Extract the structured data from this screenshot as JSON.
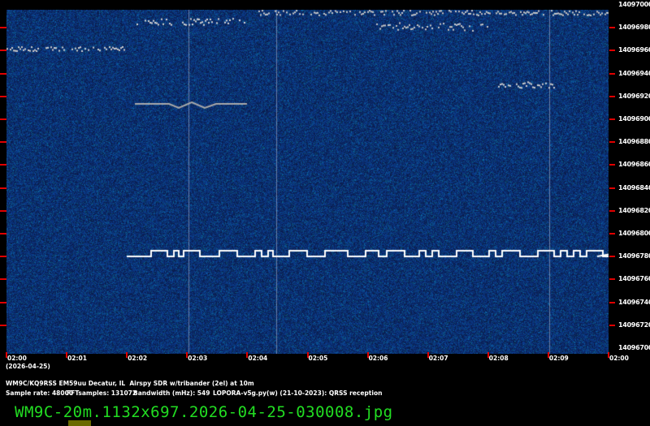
{
  "y_axis": {
    "labels": [
      "14097000",
      "14096980",
      "14096960",
      "14096940",
      "14096920",
      "14096900",
      "14096880",
      "14096860",
      "14096840",
      "14096820",
      "14096800",
      "14096780",
      "14096760",
      "14096740",
      "14096720",
      "14096700"
    ]
  },
  "x_axis": {
    "labels": [
      "02:00",
      "02:01",
      "02:02",
      "02:03",
      "02:04",
      "02:05",
      "02:06",
      "02:07",
      "02:08",
      "02:09",
      "02:00"
    ],
    "date": "(2026-04-25)"
  },
  "info": {
    "line1": "WM9C/KQ9RSS EM59uu Decatur, IL  Airspy SDR w/tribander (2el) at 10m",
    "sample_rate": "Sample rate: 48000",
    "fft": "FFTsamples: 131072",
    "bandwidth": "Bandwidth (mHz): 549",
    "software": "LOPORA-v5g.py(w) (21-10-2023): QRSS reception"
  },
  "filename": "WM9C-20m.1132x697.2026-04-25-030008.jpg",
  "colors": {
    "background": "#0a1a5a",
    "tick": "#e00000",
    "filename": "#22dd22"
  }
}
